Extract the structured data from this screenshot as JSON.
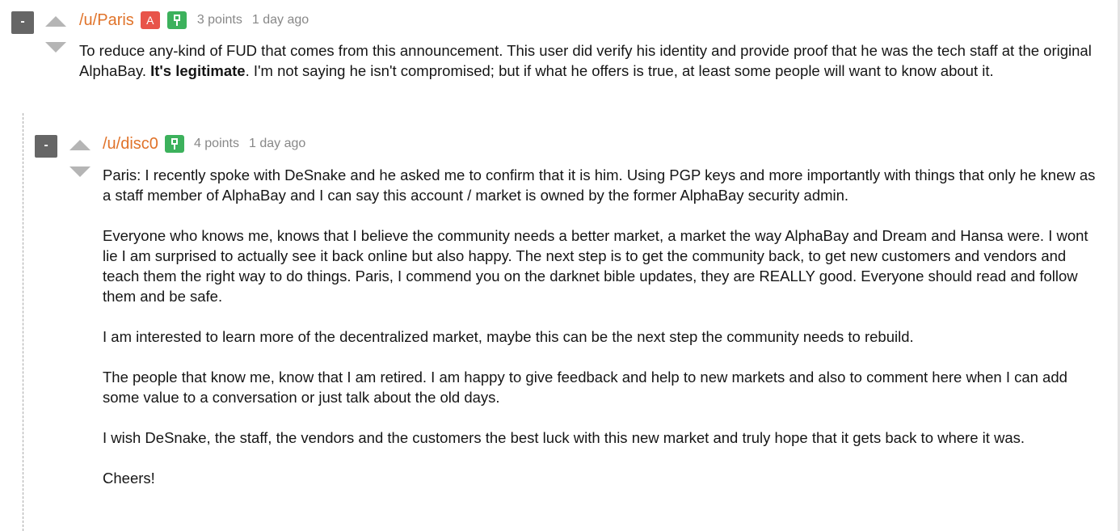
{
  "comments": [
    {
      "collapse_label": "-",
      "username": "/u/Paris",
      "admin_badge": "A",
      "points": "3 points",
      "time": "1 day ago",
      "body": {
        "p1_before": "To reduce any-kind of FUD that comes from this announcement. This user did verify his identity and provide proof that he was the tech staff at the original AlphaBay. ",
        "p1_bold": "It's legitimate",
        "p1_after": ". I'm not saying he isn't compromised; but if what he offers is true, at least some people will want to know about it."
      }
    },
    {
      "collapse_label": "-",
      "username": "/u/disc0",
      "points": "4 points",
      "time": "1 day ago",
      "paragraphs": [
        "Paris: I recently spoke with DeSnake and he asked me to confirm that it is him. Using PGP keys and more importantly with things that only he knew as a staff member of AlphaBay and I can say this account / market is owned by the former AlphaBay security admin.",
        "Everyone who knows me, knows that I believe the community needs a better market, a market the way AlphaBay and Dream and Hansa were. I wont lie I am surprised to actually see it back online but also happy. The next step is to get the community back, to get new customers and vendors and teach them the right way to do things. Paris, I commend you on the darknet bible updates, they are REALLY good. Everyone should read and follow them and be safe.",
        "I am interested to learn more of the decentralized market, maybe this can be the next step the community needs to rebuild.",
        "The people that know me, know that I am retired. I am happy to give feedback and help to new markets and also to comment here when I can add some value to a conversation or just talk about the old days.",
        "I wish DeSnake, the staff, the vendors and the customers the best luck with this new market and truly hope that it gets back to where it was.",
        "Cheers!"
      ]
    }
  ],
  "colors": {
    "username": "#e0732a",
    "admin_badge": "#e8544a",
    "verified_badge": "#3cb15c",
    "collapse_button": "#666666",
    "vote_arrow": "#b5b5b5",
    "meta_text": "#888888"
  },
  "icons": {
    "verified": "pin-icon",
    "upvote": "upvote-arrow-icon",
    "downvote": "downvote-arrow-icon"
  }
}
